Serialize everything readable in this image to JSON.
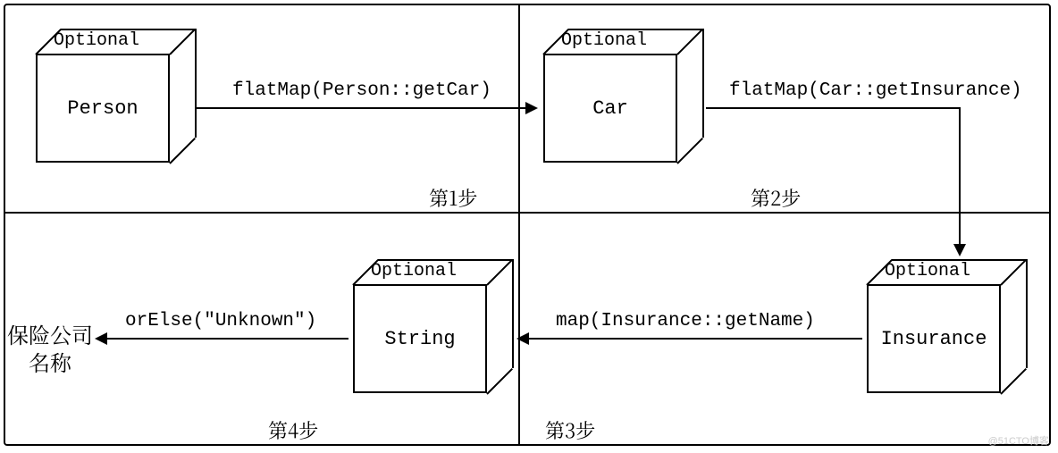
{
  "boxes": {
    "person": {
      "wrapper": "Optional",
      "content": "Person"
    },
    "car": {
      "wrapper": "Optional",
      "content": "Car"
    },
    "insurance": {
      "wrapper": "Optional",
      "content": "Insurance"
    },
    "string": {
      "wrapper": "Optional",
      "content": "String"
    }
  },
  "arrows": {
    "step1": "flatMap(Person::getCar)",
    "step2": "flatMap(Car::getInsurance)",
    "step3": "map(Insurance::getName)",
    "step4": "orElse(\"Unknown\")"
  },
  "steps": {
    "s1": "第1步",
    "s2": "第2步",
    "s3": "第3步",
    "s4": "第4步"
  },
  "final_label": "保险公司\n名称",
  "watermark": "@51CTO博客"
}
